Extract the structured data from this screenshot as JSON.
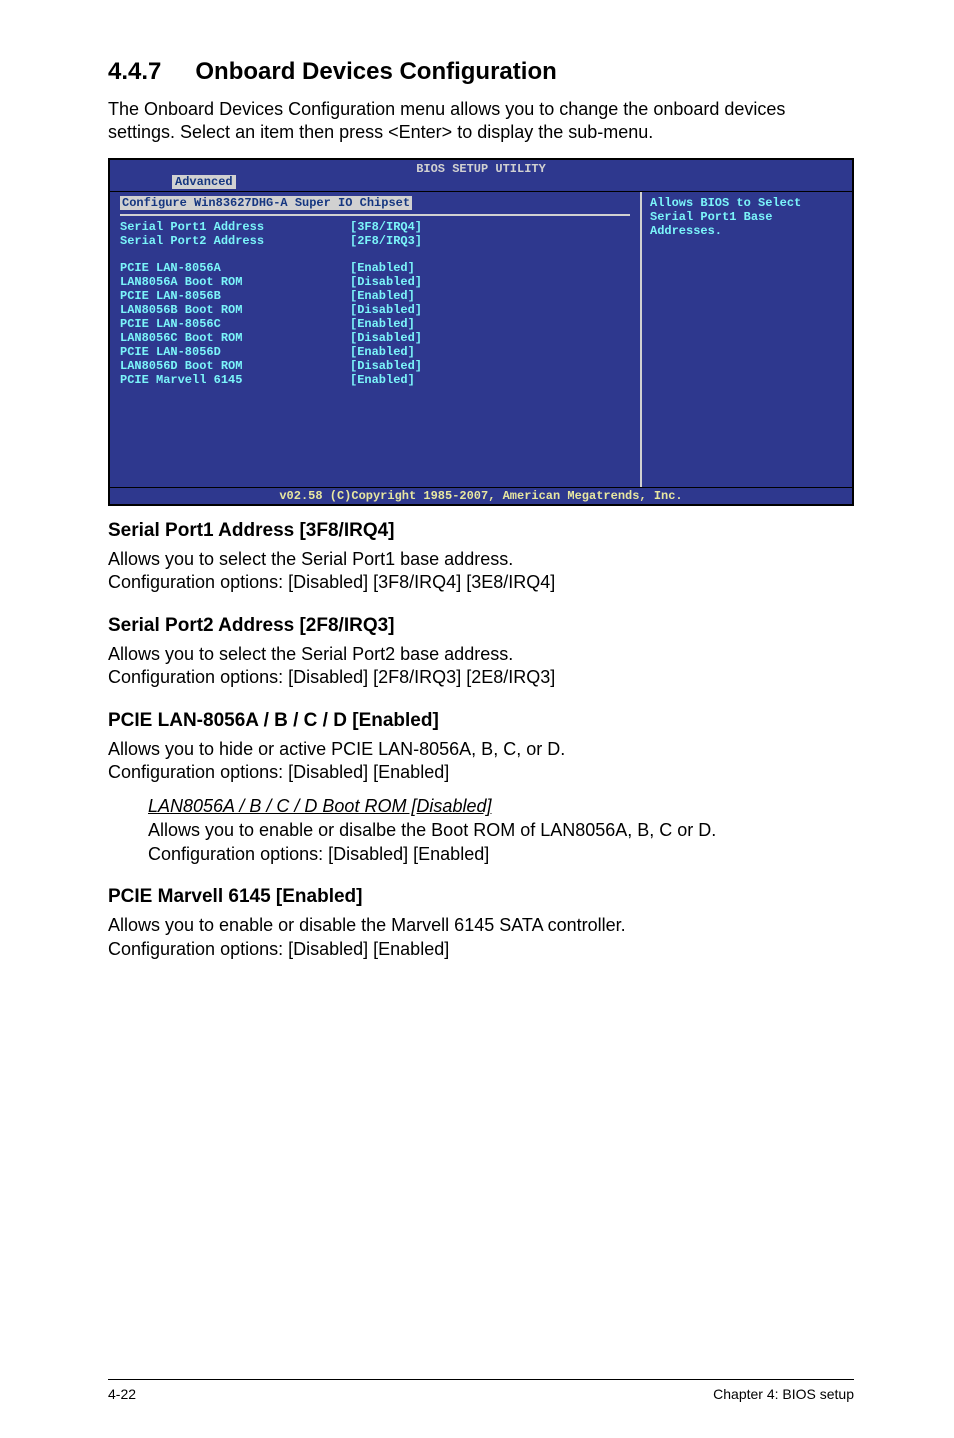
{
  "section": {
    "number": "4.4.7",
    "title": "Onboard Devices Configuration"
  },
  "intro": "The Onboard Devices Configuration menu allows you to change the onboard devices settings. Select an item then press <Enter> to display the sub-menu.",
  "bios": {
    "title": "BIOS SETUP UTILITY",
    "tab": "Advanced",
    "configHeader": "Configure Win83627DHG-A Super IO Chipset",
    "rows": [
      {
        "label": "Serial Port1 Address",
        "value": "[3F8/IRQ4]"
      },
      {
        "label": "Serial Port2 Address",
        "value": "[2F8/IRQ3]"
      }
    ],
    "rows2": [
      {
        "label": "PCIE LAN-8056A",
        "value": "[Enabled]"
      },
      {
        "label": "LAN8056A Boot ROM",
        "value": "[Disabled]"
      },
      {
        "label": "PCIE LAN-8056B",
        "value": "[Enabled]"
      },
      {
        "label": "LAN8056B Boot ROM",
        "value": "[Disabled]"
      },
      {
        "label": "PCIE LAN-8056C",
        "value": "[Enabled]"
      },
      {
        "label": "LAN8056C Boot ROM",
        "value": "[Disabled]"
      },
      {
        "label": "PCIE LAN-8056D",
        "value": "[Enabled]"
      },
      {
        "label": "LAN8056D Boot ROM",
        "value": "[Disabled]"
      },
      {
        "label": "PCIE Marvell 6145",
        "value": "[Enabled]"
      }
    ],
    "help": "Allows BIOS to Select Serial Port1 Base Addresses.",
    "footer": "v02.58 (C)Copyright 1985-2007, American Megatrends, Inc."
  },
  "subsections": [
    {
      "heading": "Serial Port1 Address [3F8/IRQ4]",
      "desc": "Allows you to select the Serial Port1 base address.\nConfiguration options: [Disabled] [3F8/IRQ4] [3E8/IRQ4]"
    },
    {
      "heading": "Serial Port2 Address [2F8/IRQ3]",
      "desc": "Allows you to select the Serial Port2 base address.\nConfiguration options: [Disabled] [2F8/IRQ3] [2E8/IRQ3]"
    },
    {
      "heading": "PCIE LAN-8056A / B / C / D [Enabled]",
      "desc": "Allows you to hide or active PCIE LAN-8056A, B, C, or D.\nConfiguration options: [Disabled] [Enabled]",
      "indent": {
        "title": "LAN8056A / B / C / D Boot ROM [Disabled]",
        "desc": "Allows you to enable or disalbe the Boot ROM of LAN8056A, B, C or D.\nConfiguration options: [Disabled] [Enabled]"
      }
    },
    {
      "heading": "PCIE Marvell 6145 [Enabled]",
      "desc": "Allows you to enable or disable the Marvell 6145 SATA controller.\nConfiguration options: [Disabled] [Enabled]"
    }
  ],
  "footer": {
    "left": "4-22",
    "right": "Chapter 4: BIOS setup"
  }
}
